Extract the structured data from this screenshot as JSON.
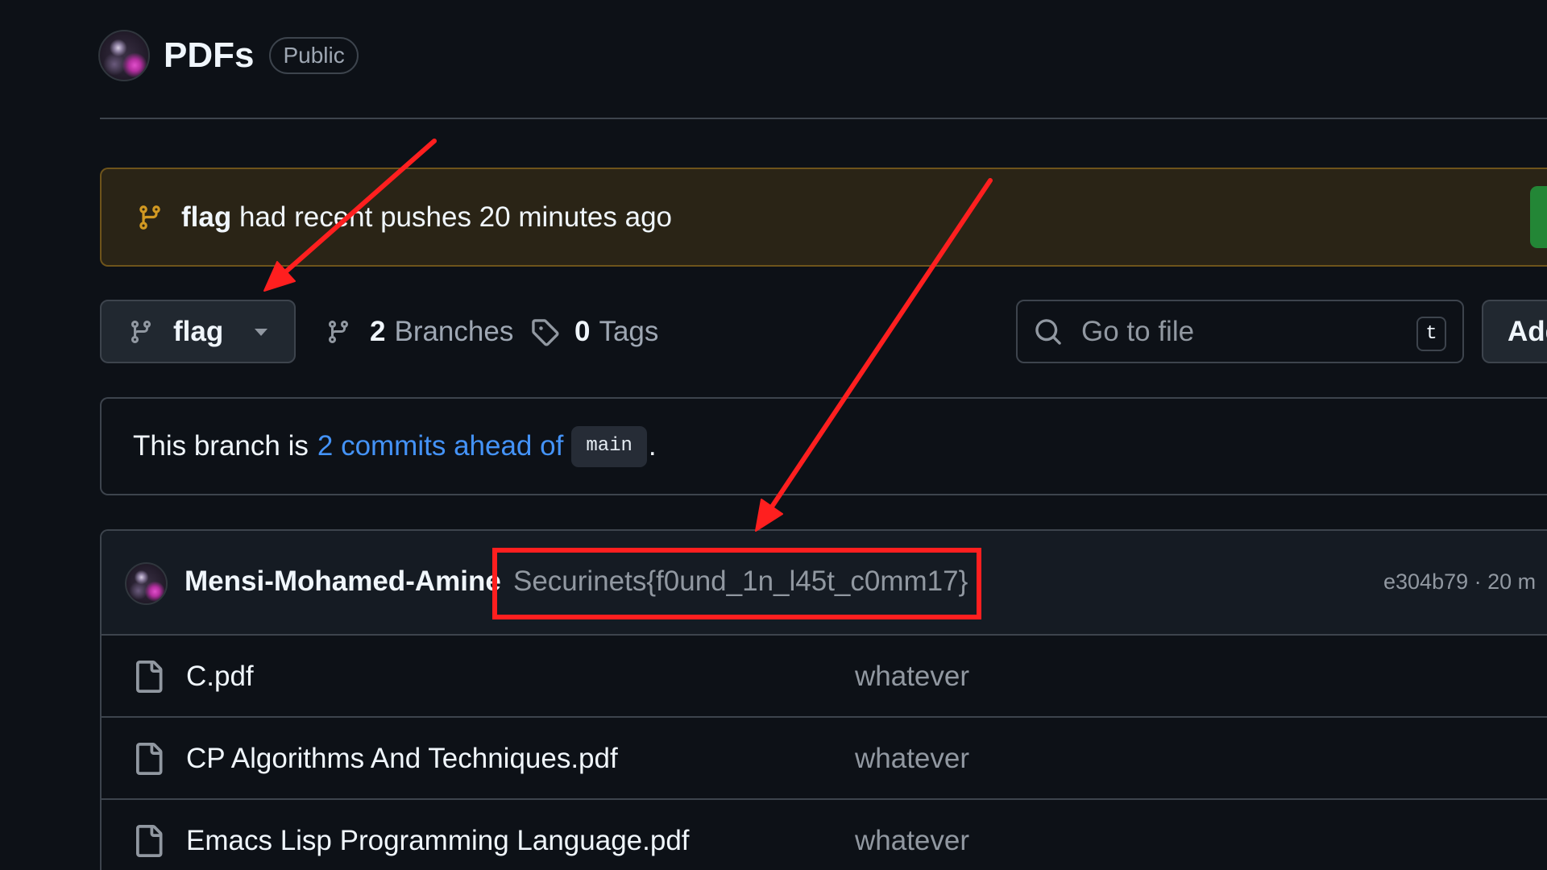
{
  "repo": {
    "name": "PDFs",
    "visibility": "Public"
  },
  "push_banner": {
    "branch": "flag",
    "message": "had recent pushes 20 minutes ago"
  },
  "toolbar": {
    "branch_selector": "flag",
    "branches_count": "2",
    "branches_label": "Branches",
    "tags_count": "0",
    "tags_label": "Tags",
    "search_placeholder": "Go to file",
    "search_shortcut": "t",
    "add_button": "Add"
  },
  "branch_status": {
    "prefix": "This branch is",
    "ahead_link": "2 commits ahead of",
    "base_branch": "main",
    "suffix": "."
  },
  "latest_commit": {
    "author": "Mensi-Mohamed-Amine",
    "message": "Securinets{f0und_1n_l45t_c0mm17}",
    "meta": "e304b79 · 20 m"
  },
  "files": [
    {
      "name": "C.pdf",
      "commit_message": "whatever"
    },
    {
      "name": "CP Algorithms And Techniques.pdf",
      "commit_message": "whatever"
    },
    {
      "name": "Emacs Lisp Programming Language.pdf",
      "commit_message": "whatever"
    }
  ],
  "icons": {
    "banner": "git-branch-icon",
    "branch_selector": "git-branch-icon",
    "branches": "git-branch-icon",
    "tags": "tag-icon",
    "search": "search-icon",
    "file": "file-icon",
    "dropdown": "caret-down-icon"
  },
  "colors": {
    "background": "#0d1117",
    "text": "#f0f6fc",
    "muted": "#9198a1",
    "link": "#4493f8",
    "border": "#3d444d",
    "banner_background": "#2a2416",
    "banner_border": "#6e541b",
    "attention": "#d29922",
    "success": "#238636",
    "annotation": "#ff1f1f"
  }
}
